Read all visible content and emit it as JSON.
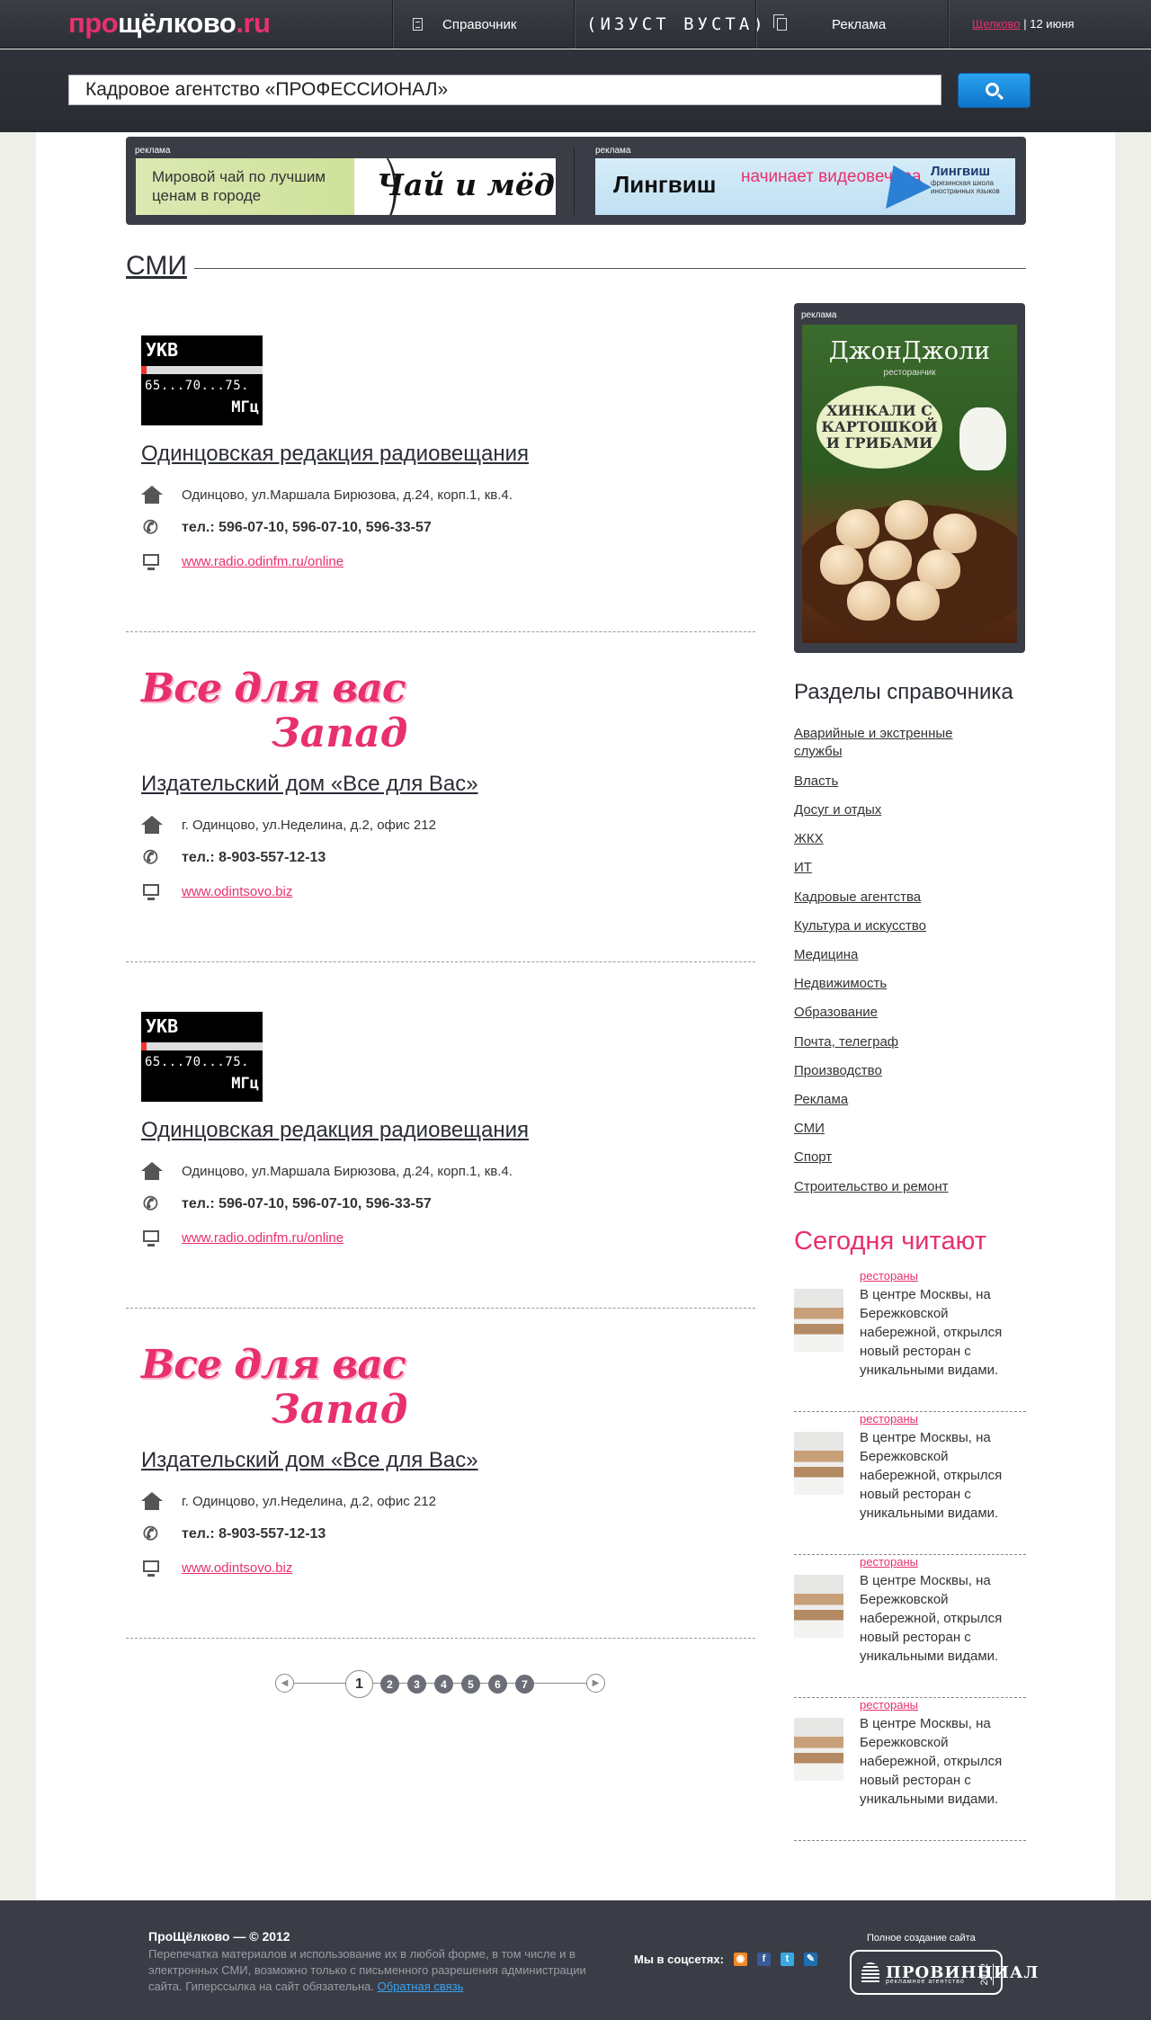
{
  "header": {
    "logo_pre": "про",
    "logo_mid": "щёлково",
    "logo_tld": ".ru",
    "nav": [
      {
        "label": "Справочник",
        "icon": "document-icon"
      },
      {
        "label": "(ИЗУСТ ВУСТА)",
        "icon": "brand-logo"
      },
      {
        "label": "Реклама",
        "icon": "copy-icon"
      }
    ],
    "city": "Щелково",
    "date": "12 июня"
  },
  "search": {
    "value": "Кадровое агентство «ПРОФЕССИОНАЛ»",
    "button_icon": "search-icon"
  },
  "ads": {
    "tag": "реклама",
    "ad1_text": "Мировой чай по лучшим ценам в городе",
    "ad1_logo": "Чай и мёд",
    "ad2_brand": "Лингвиш",
    "ad2_text": "начинает видеовечера",
    "ad2_logo": "Лингвиш",
    "ad2_logo_sub": "фрезинская школа иностранных языков",
    "side_brand": "ДжонДжоли",
    "side_sub": "ресторанчик",
    "side_bubble": "ХИНКАЛИ С КАРТОШКОЙ И ГРИБАМИ"
  },
  "section": {
    "title": "СМИ"
  },
  "listings": [
    {
      "kind": "radio",
      "title": "Одинцовская редакция радиовещания",
      "address": "Одинцово, ул.Маршала Бирюзова, д.24, корп.1, кв.4.",
      "phone": "тел.: 596-07-10, 596-07-10, 596-33-57",
      "site": "www.radio.odinfm.ru/online",
      "thumb_a": "УКВ",
      "thumb_b": "65...70...75.",
      "thumb_c": "МГц"
    },
    {
      "kind": "logo",
      "title": "Издательский дом «Все для Вас»",
      "address": "г. Одинцово, ул.Неделина, д.2, офис 212",
      "phone": "тел.: 8-903-557-12-13",
      "site": "www.odintsovo.biz",
      "thumb_a": "Все для вас",
      "thumb_b": "Запад"
    },
    {
      "kind": "radio",
      "title": "Одинцовская редакция радиовещания",
      "address": "Одинцово, ул.Маршала Бирюзова, д.24, корп.1, кв.4.",
      "phone": "тел.: 596-07-10, 596-07-10, 596-33-57",
      "site": "www.radio.odinfm.ru/online",
      "thumb_a": "УКВ",
      "thumb_b": "65...70...75.",
      "thumb_c": "МГц"
    },
    {
      "kind": "logo",
      "title": "Издательский дом «Все для Вас»",
      "address": "г. Одинцово, ул.Неделина, д.2, офис 212",
      "phone": "тел.: 8-903-557-12-13",
      "site": "www.odintsovo.biz",
      "thumb_a": "Все для вас",
      "thumb_b": "Запад"
    }
  ],
  "pagination": {
    "pages": [
      "1",
      "2",
      "3",
      "4",
      "5",
      "6",
      "7"
    ],
    "current": "1"
  },
  "directory": {
    "title": "Разделы справочника",
    "items": [
      "Аварийные и экстренные службы",
      "Власть",
      "Досуг и отдых",
      "ЖКХ",
      "ИТ",
      "Кадровые агентства",
      "Культура и искусство",
      "Медицина",
      "Недвижимость",
      "Образование",
      "Почта, телеграф",
      "Производство",
      "Реклама",
      "СМИ",
      "Спорт",
      "Строительство и ремонт"
    ]
  },
  "reading": {
    "title": "Сегодня читают",
    "items": [
      {
        "category": "рестораны",
        "text": "В центре Москвы, на Бережковской набережной, открылся новый ресторан с уникальными видами."
      },
      {
        "category": "рестораны",
        "text": "В центре Москвы, на Бережковской набережной, открылся новый ресторан с уникальными видами."
      },
      {
        "category": "рестораны",
        "text": "В центре Москвы, на Бережковской набережной, открылся новый ресторан с уникальными видами."
      },
      {
        "category": "рестораны",
        "text": "В центре Москвы, на Бережковской набережной, открылся новый ресторан с уникальными видами."
      }
    ]
  },
  "footer": {
    "copyright": "ПроЩёлково — © 2012",
    "notice": "Перепечатка материалов и использование их в любой форме, в том числе и в электронных СМИ, возможно только с письменного разрешения администрации сайта. Гиперссылка на сайт обязательна.",
    "feedback": "Обратная связь",
    "social_label": "Мы в соцсетях:",
    "social_icons": [
      "rss-icon",
      "facebook-icon",
      "twitter-icon",
      "livejournal-icon"
    ],
    "made_by": "Полное создание сайта",
    "agency": "ПРОВИНЦИАЛ",
    "agency_sub": "рекламное агентство",
    "agency_year": "2012"
  },
  "colors": {
    "accent": "#e8306c",
    "dark": "#3a3d46",
    "button": "#1a8ae0"
  }
}
